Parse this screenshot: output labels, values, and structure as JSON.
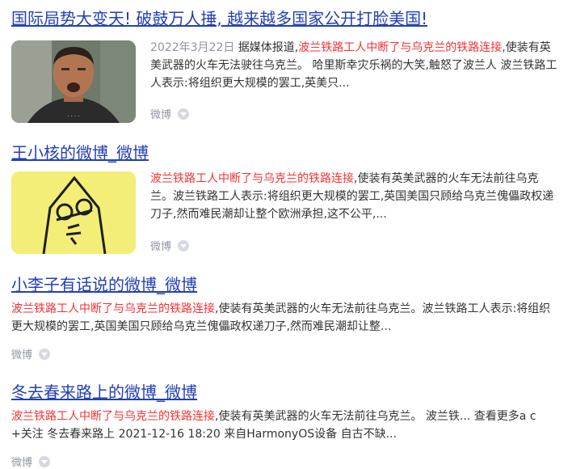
{
  "results": [
    {
      "title": "国际局势大变天! 破鼓万人捶, 越来越多国家公开打脸美国!",
      "date": "2022年3月22日",
      "text_pre": " 据媒体报道,",
      "highlight": "波兰铁路工人中断了与乌克兰的铁路连接",
      "text_post": ",使装有英美武器的火车无法驶往乌克兰。 哈里斯幸灾乐祸的大笑,触怒了波兰人 波兰铁路工人表示:将组织更大规模的罢工,英美只...",
      "source": "微博",
      "thumb_icon": "man-portrait-photo"
    },
    {
      "title": "王小核的微博_微博",
      "highlight": "波兰铁路工人中断了与乌克兰的铁路连接",
      "text_post": ",使装有英美武器的火车无法前往乌克兰。波兰铁路工人表示:将组织更大规模的罢工,英国美国只顾给乌克兰傀儡政权递刀子,然而难民潮却让整个欧洲承担,这不公平,...",
      "source": "微博",
      "thumb_icon": "cartoon-avatar"
    },
    {
      "title": "小李子有话说的微博_微博",
      "highlight": "波兰铁路工人中断了与乌克兰的铁路连接",
      "text_post": ",使装有英美武器的火车无法前往乌克兰。波兰铁路工人表示:将组织更大规模的罢工,英国美国只顾给乌克兰傀儡政权递刀子,然而难民潮却让整...",
      "source": "微博"
    },
    {
      "title": "冬去春来路上的微博_微博",
      "highlight": "波兰铁路工人中断了与乌克兰的铁路连接",
      "text_post": ",使装有英美武器的火车无法前往乌克兰。 波兰铁... 查看更多a c +关注 冬去春来路上 2021-12-16 18:20 来自HarmonyOS设备 自古不缺...",
      "source": "微博"
    }
  ]
}
